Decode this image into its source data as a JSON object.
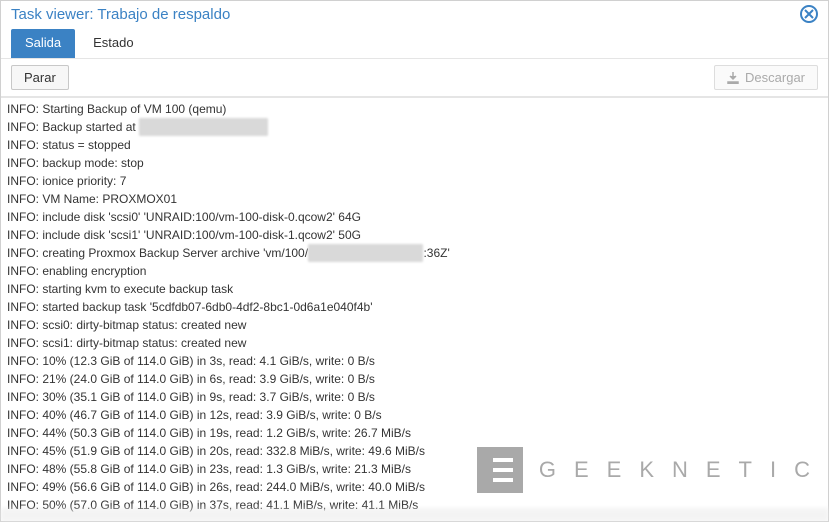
{
  "header": {
    "title": "Task viewer: Trabajo de respaldo"
  },
  "tabs": {
    "output": "Salida",
    "status": "Estado"
  },
  "toolbar": {
    "stop": "Parar",
    "download": "Descargar"
  },
  "log": {
    "l00": "INFO: Starting Backup of VM 100 (qemu)",
    "l01_a": "INFO: Backup started at ",
    "l01_b": "████████  ██ ██:██",
    "l02": "INFO: status = stopped",
    "l03": "INFO: backup mode: stop",
    "l04": "INFO: ionice priority: 7",
    "l05": "INFO: VM Name: PROXMOX01",
    "l06": "INFO: include disk 'scsi0' 'UNRAID:100/vm-100-disk-0.qcow2' 64G",
    "l07": "INFO: include disk 'scsi1' 'UNRAID:100/vm-100-disk-1.qcow2' 50G",
    "l08_a": "INFO: creating Proxmox Backup Server archive 'vm/100/",
    "l08_b": "████ ██ ██  ██ ██",
    "l08_c": ":36Z'",
    "l09": "INFO: enabling encryption",
    "l10": "INFO: starting kvm to execute backup task",
    "l11": "INFO: started backup task '5cdfdb07-6db0-4df2-8bc1-0d6a1e040f4b'",
    "l12": "INFO: scsi0: dirty-bitmap status: created new",
    "l13": "INFO: scsi1: dirty-bitmap status: created new",
    "l14": "INFO:  10% (12.3 GiB of 114.0 GiB) in 3s, read: 4.1 GiB/s, write: 0 B/s",
    "l15": "INFO:  21% (24.0 GiB of 114.0 GiB) in 6s, read: 3.9 GiB/s, write: 0 B/s",
    "l16": "INFO:  30% (35.1 GiB of 114.0 GiB) in 9s, read: 3.7 GiB/s, write: 0 B/s",
    "l17": "INFO:  40% (46.7 GiB of 114.0 GiB) in 12s, read: 3.9 GiB/s, write: 0 B/s",
    "l18": "INFO:  44% (50.3 GiB of 114.0 GiB) in 19s, read: 1.2 GiB/s, write: 26.7 MiB/s",
    "l19": "INFO:  45% (51.9 GiB of 114.0 GiB) in 20s, read: 332.8 MiB/s, write: 49.6 MiB/s",
    "l20": "INFO:  48% (55.8 GiB of 114.0 GiB) in 23s, read: 1.3 GiB/s, write: 21.3 MiB/s",
    "l21": "INFO:  49% (56.6 GiB of 114.0 GiB) in 26s, read: 244.0 MiB/s, write: 40.0 MiB/s",
    "l22": "INFO:  50% (57.0 GiB of 114.0 GiB) in 37s, read: 41.1 MiB/s, write: 41.1 MiB/s"
  },
  "watermark": {
    "text": "GEEKNETIC"
  }
}
